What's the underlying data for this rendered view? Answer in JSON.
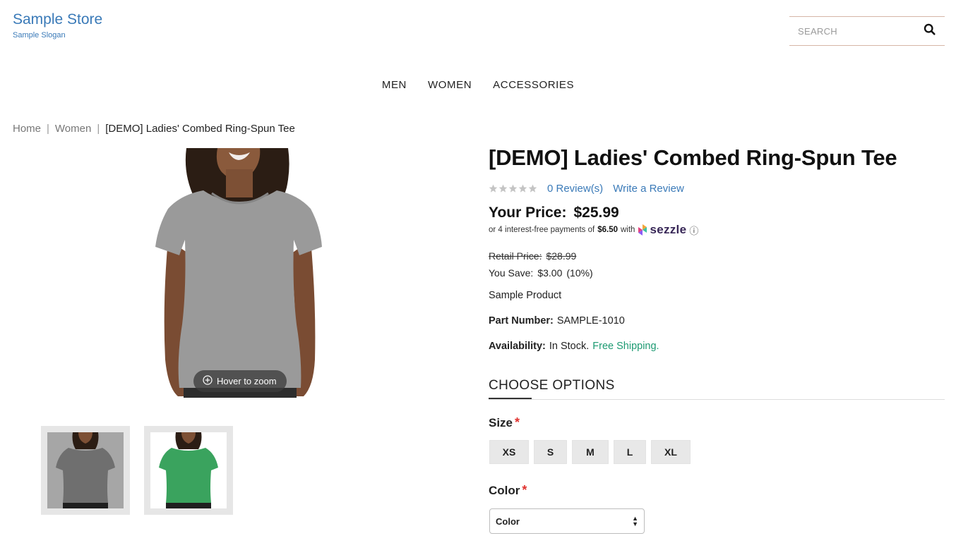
{
  "store": {
    "name": "Sample Store",
    "slogan": "Sample Slogan"
  },
  "search": {
    "placeholder": "SEARCH"
  },
  "nav": [
    "MEN",
    "WOMEN",
    "ACCESSORIES"
  ],
  "breadcrumb": [
    "Home",
    "Women",
    "[DEMO] Ladies' Combed Ring-Spun Tee"
  ],
  "breadcrumb_separator": "|",
  "image": {
    "zoom_hint": "Hover to zoom"
  },
  "product": {
    "title": "[DEMO] Ladies' Combed Ring-Spun Tee",
    "rating": 0,
    "reviews_label": "0 Review(s)",
    "write_review_label": "Write a Review",
    "price_label": "Your Price:",
    "price": "$25.99",
    "sezzle": {
      "prefix": "or 4 interest-free payments of",
      "amount": "$6.50",
      "with": "with",
      "brand": "sezzle",
      "info": "ⓘ"
    },
    "retail_label": "Retail Price:",
    "retail_price": "$28.99",
    "save_label": "You Save:",
    "save_value": "$3.00",
    "save_percent": "(10%)",
    "description": "Sample Product",
    "part_label": "Part Number:",
    "part_number": "SAMPLE-1010",
    "availability_label": "Availability:",
    "availability": "In Stock.",
    "shipping": "Free Shipping."
  },
  "options": {
    "heading": "CHOOSE OPTIONS",
    "size_label": "Size",
    "required_mark": "*",
    "sizes": [
      "XS",
      "S",
      "M",
      "L",
      "XL"
    ],
    "color_label": "Color",
    "color_selected": "Color"
  },
  "colors": {
    "link": "#3a7ab8",
    "free_shipping": "#1d9a72",
    "required": "#e0332f",
    "shirt_gray": "#9a9a9a",
    "shirt_green": "#3aa35e"
  }
}
